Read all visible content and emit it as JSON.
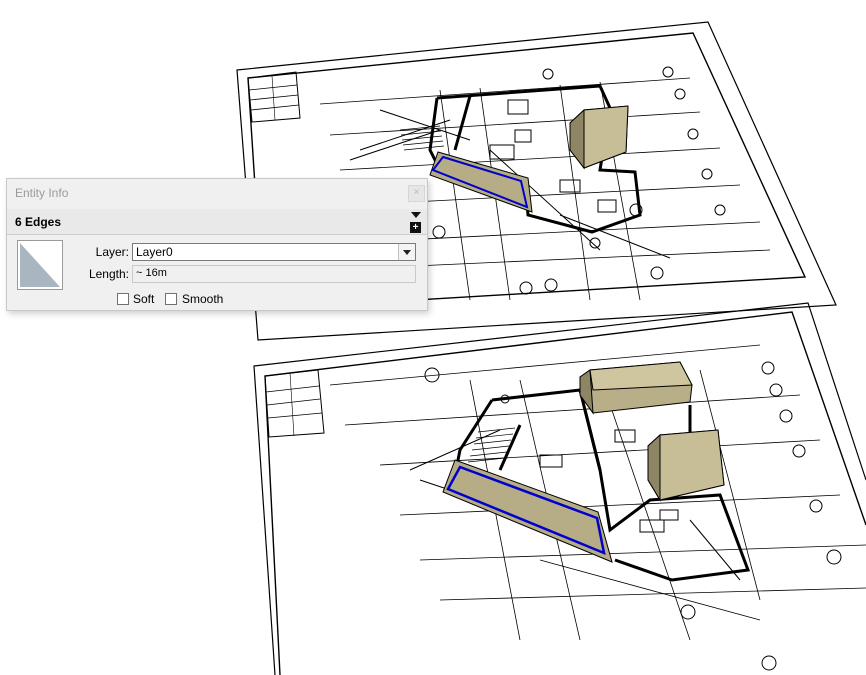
{
  "entity_info": {
    "title": "Entity Info",
    "close_label": "×",
    "selection": "6 Edges",
    "expand_label": "+",
    "layer_label": "Layer:",
    "layer_value": "Layer0",
    "length_label": "Length:",
    "length_value": "~ 16m",
    "soft_label": "Soft",
    "smooth_label": "Smooth",
    "soft_checked": false,
    "smooth_checked": false
  },
  "viewport": {
    "scene": "two floor plan sheets shown in 3D perspective with tan box volumes",
    "volume_color": "#b6ac86",
    "selected_edge_color": "#0000cc"
  }
}
